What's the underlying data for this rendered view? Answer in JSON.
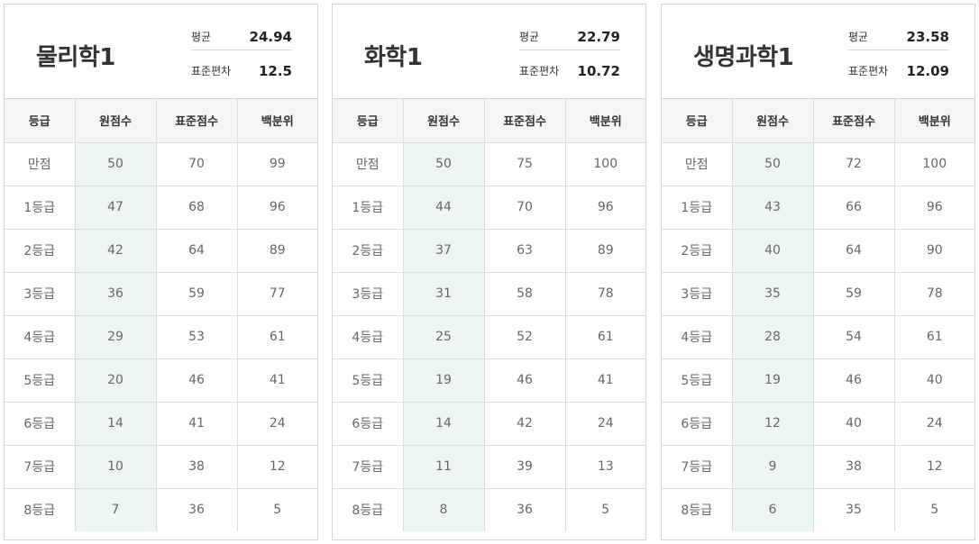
{
  "columns": [
    "등급",
    "원점수",
    "표준점수",
    "백분위"
  ],
  "stat_labels": {
    "average": "평균",
    "std_dev": "표준편차"
  },
  "colors": {
    "raw_column_bg": "#eef5f5",
    "header_bg": "#f5f5f5",
    "border": "#d4d4d4"
  },
  "subjects": [
    {
      "name": "물리학1",
      "average": "24.94",
      "std_dev": "12.5",
      "rows": [
        {
          "grade": "만점",
          "raw": "50",
          "standard": "70",
          "percentile": "99"
        },
        {
          "grade": "1등급",
          "raw": "47",
          "standard": "68",
          "percentile": "96"
        },
        {
          "grade": "2등급",
          "raw": "42",
          "standard": "64",
          "percentile": "89"
        },
        {
          "grade": "3등급",
          "raw": "36",
          "standard": "59",
          "percentile": "77"
        },
        {
          "grade": "4등급",
          "raw": "29",
          "standard": "53",
          "percentile": "61"
        },
        {
          "grade": "5등급",
          "raw": "20",
          "standard": "46",
          "percentile": "41"
        },
        {
          "grade": "6등급",
          "raw": "14",
          "standard": "41",
          "percentile": "24"
        },
        {
          "grade": "7등급",
          "raw": "10",
          "standard": "38",
          "percentile": "12"
        },
        {
          "grade": "8등급",
          "raw": "7",
          "standard": "36",
          "percentile": "5"
        }
      ]
    },
    {
      "name": "화학1",
      "average": "22.79",
      "std_dev": "10.72",
      "rows": [
        {
          "grade": "만점",
          "raw": "50",
          "standard": "75",
          "percentile": "100"
        },
        {
          "grade": "1등급",
          "raw": "44",
          "standard": "70",
          "percentile": "96"
        },
        {
          "grade": "2등급",
          "raw": "37",
          "standard": "63",
          "percentile": "89"
        },
        {
          "grade": "3등급",
          "raw": "31",
          "standard": "58",
          "percentile": "78"
        },
        {
          "grade": "4등급",
          "raw": "25",
          "standard": "52",
          "percentile": "61"
        },
        {
          "grade": "5등급",
          "raw": "19",
          "standard": "46",
          "percentile": "41"
        },
        {
          "grade": "6등급",
          "raw": "14",
          "standard": "42",
          "percentile": "24"
        },
        {
          "grade": "7등급",
          "raw": "11",
          "standard": "39",
          "percentile": "13"
        },
        {
          "grade": "8등급",
          "raw": "8",
          "standard": "36",
          "percentile": "5"
        }
      ]
    },
    {
      "name": "생명과학1",
      "average": "23.58",
      "std_dev": "12.09",
      "rows": [
        {
          "grade": "만점",
          "raw": "50",
          "standard": "72",
          "percentile": "100"
        },
        {
          "grade": "1등급",
          "raw": "43",
          "standard": "66",
          "percentile": "96"
        },
        {
          "grade": "2등급",
          "raw": "40",
          "standard": "64",
          "percentile": "90"
        },
        {
          "grade": "3등급",
          "raw": "35",
          "standard": "59",
          "percentile": "78"
        },
        {
          "grade": "4등급",
          "raw": "28",
          "standard": "54",
          "percentile": "61"
        },
        {
          "grade": "5등급",
          "raw": "19",
          "standard": "46",
          "percentile": "40"
        },
        {
          "grade": "6등급",
          "raw": "12",
          "standard": "40",
          "percentile": "24"
        },
        {
          "grade": "7등급",
          "raw": "9",
          "standard": "38",
          "percentile": "12"
        },
        {
          "grade": "8등급",
          "raw": "6",
          "standard": "35",
          "percentile": "5"
        }
      ]
    }
  ]
}
